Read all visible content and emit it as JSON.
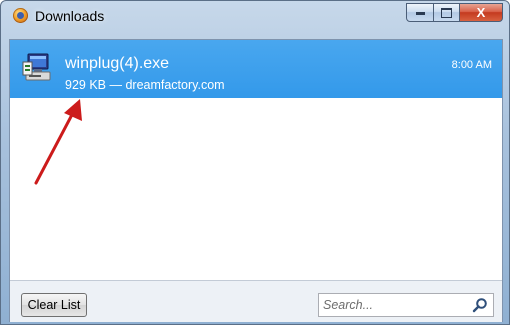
{
  "window": {
    "title": "Downloads",
    "icon": "firefox-icon",
    "controls": {
      "minimize": "minimize-icon",
      "maximize": "maximize-icon",
      "close_label": "X"
    }
  },
  "downloads": [
    {
      "filename": "winplug(4).exe",
      "details": "929 KB — dreamfactory.com",
      "time": "8:00 AM",
      "icon": "installer-icon",
      "selected": true
    }
  ],
  "annotation": {
    "icon": "red-arrow-icon",
    "color": "#cc1b1b"
  },
  "footer": {
    "clear_list_label": "Clear List",
    "search_placeholder": "Search..."
  },
  "colors": {
    "selection": "#3399ea",
    "close_button": "#c43a1f"
  }
}
